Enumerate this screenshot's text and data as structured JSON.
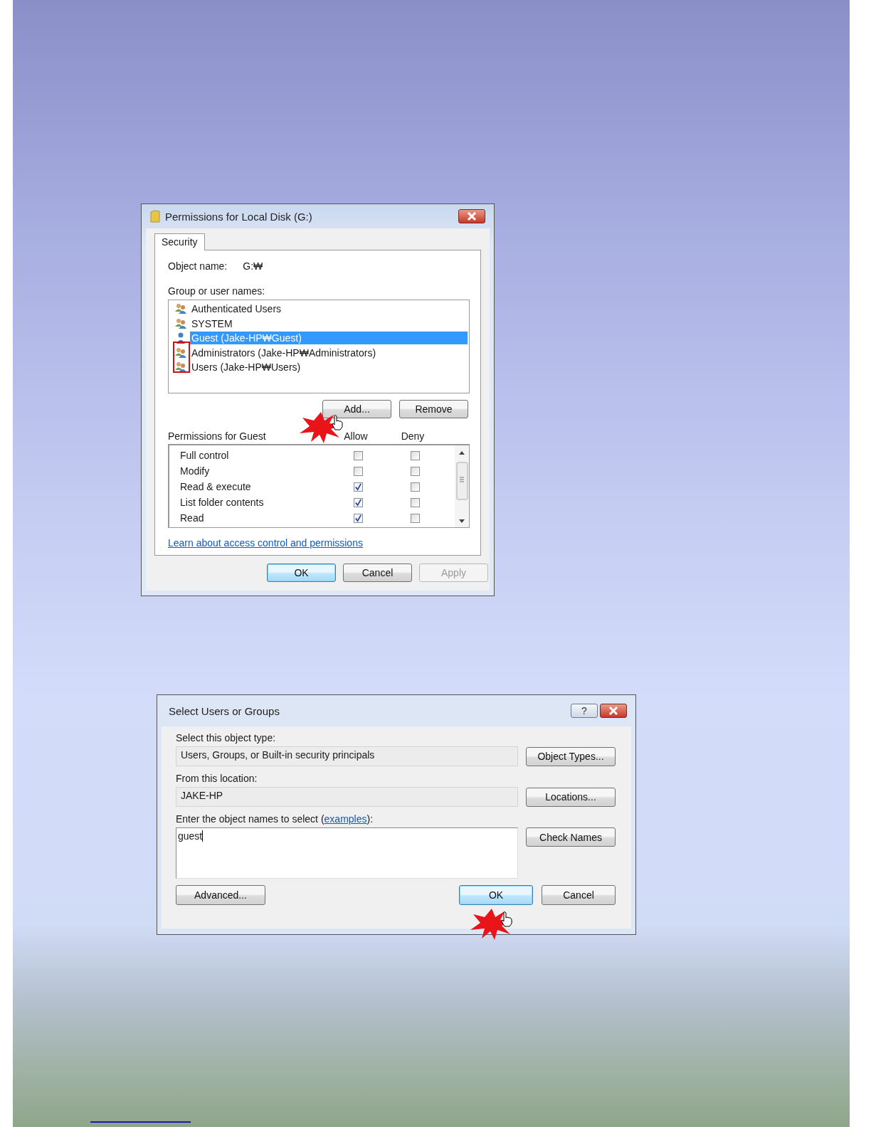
{
  "permissions_dialog": {
    "title": "Permissions for Local Disk (G:)",
    "tabs": [
      {
        "label": "Security",
        "selected": true
      }
    ],
    "object_name": {
      "label": "Object name:",
      "value": "G:₩"
    },
    "groups_label": "Group or user names:",
    "groups": [
      {
        "name": "Authenticated Users",
        "kind": "group",
        "selected": false
      },
      {
        "name": "SYSTEM",
        "kind": "group",
        "selected": false
      },
      {
        "name": "Guest (Jake-HP₩Guest)",
        "kind": "user",
        "selected": true
      },
      {
        "name": "Administrators (Jake-HP₩Administrators)",
        "kind": "group",
        "selected": false
      },
      {
        "name": "Users (Jake-HP₩Users)",
        "kind": "group",
        "selected": false
      }
    ],
    "list_buttons": [
      "Add...",
      "Remove"
    ],
    "permissions_label": "Permissions for Guest",
    "columns": [
      "Allow",
      "Deny"
    ],
    "permissions": [
      {
        "name": "Full control",
        "allow": false,
        "deny": false
      },
      {
        "name": "Modify",
        "allow": false,
        "deny": false
      },
      {
        "name": "Read & execute",
        "allow": true,
        "deny": false
      },
      {
        "name": "List folder contents",
        "allow": true,
        "deny": false
      },
      {
        "name": "Read",
        "allow": true,
        "deny": false
      }
    ],
    "link": "Learn about access control and permissions",
    "buttons": [
      {
        "label": "OK",
        "disabled": false,
        "default": true
      },
      {
        "label": "Cancel",
        "disabled": false,
        "default": false
      },
      {
        "label": "Apply",
        "disabled": true,
        "default": false
      }
    ]
  },
  "select_dialog": {
    "title": "Select Users or Groups",
    "help": "?",
    "object_type": {
      "label": "Select this object type:",
      "value": "Users, Groups, or Built-in security principals",
      "button": "Object Types..."
    },
    "location": {
      "label": "From this location:",
      "value": "JAKE-HP",
      "button": "Locations..."
    },
    "names": {
      "label": "Enter the object names to select (",
      "link": "examples",
      "label_end": "):",
      "value": "guest",
      "button": "Check Names"
    },
    "advanced": "Advanced...",
    "buttons": [
      {
        "label": "OK",
        "default": true
      },
      {
        "label": "Cancel",
        "default": false
      }
    ]
  }
}
